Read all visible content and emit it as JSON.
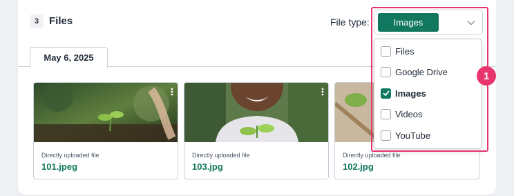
{
  "header": {
    "file_count": "3",
    "title": "Files",
    "file_type_label": "File type:",
    "selected_value": "Images"
  },
  "tabs": [
    {
      "label": "May 6, 2025"
    }
  ],
  "dropdown": {
    "options": [
      {
        "label": "Files",
        "checked": false
      },
      {
        "label": "Google Drive",
        "checked": false
      },
      {
        "label": "Images",
        "checked": true
      },
      {
        "label": "Videos",
        "checked": false
      },
      {
        "label": "YouTube",
        "checked": false
      }
    ]
  },
  "cards": [
    {
      "caption": "Directly uploaded file",
      "filename": "101.jpeg"
    },
    {
      "caption": "Directly uploaded file",
      "filename": "103.jpg"
    },
    {
      "caption": "Directly uploaded file",
      "filename": "102.jpg"
    }
  ],
  "annotation": {
    "marker_label": "1",
    "color": "#e8356d"
  },
  "colors": {
    "accent": "#11785f"
  },
  "icons": {
    "select_chevron": "chevron-down-icon",
    "card_menu": "kebab-menu-icon",
    "checkbox_check": "check-icon"
  }
}
